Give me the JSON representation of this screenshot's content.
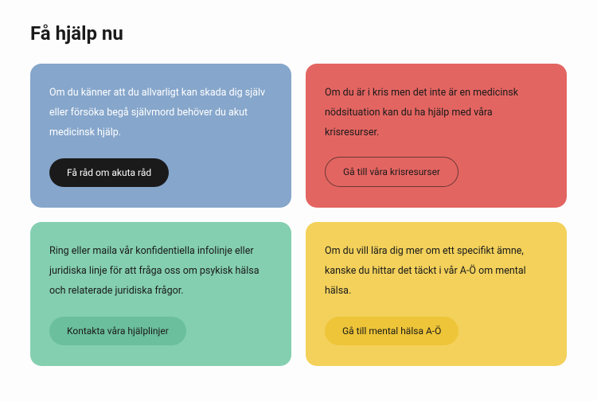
{
  "title": "Få hjälp nu",
  "cards": [
    {
      "text": "Om du känner att du allvarligt kan skada dig själv eller försöka begå självmord behöver du akut medicinsk hjälp.",
      "button": "Få råd om akuta råd",
      "color": "#86a6cb"
    },
    {
      "text": "Om du är i kris men det inte är en medicinsk nödsituation kan du ha hjälp med våra krisresurser.",
      "button": "Gå till våra krisresurser",
      "color": "#e36561"
    },
    {
      "text": "Ring eller maila vår konfidentiella infolinje eller juridiska linje för att fråga oss om psykisk hälsa och relaterade juridiska frågor.",
      "button": "Kontakta våra hjälplinjer",
      "color": "#84cfb0"
    },
    {
      "text": "Om du vill lära dig mer om ett specifikt ämne, kanske du hittar det täckt i vår A-Ö om mental hälsa.",
      "button": "Gå till mental hälsa A-Ö",
      "color": "#f3d15b"
    }
  ]
}
